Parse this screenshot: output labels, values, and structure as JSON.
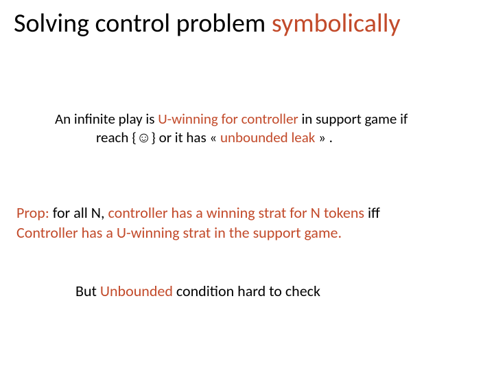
{
  "title": {
    "plain": "Solving control problem ",
    "accent": "symbolically"
  },
  "para1": {
    "line1_a": "An infinite play is ",
    "line1_u": "U-winning for controller",
    "line1_b": " in support game if",
    "line2_a": "reach {",
    "line2_smile": "☺",
    "line2_b": "} or it has « ",
    "line2_u": "unbounded leak",
    "line2_c": " » ."
  },
  "para2": {
    "l1_a": "Prop: ",
    "l1_b": "for all N, ",
    "l1_c": "controller has a winning  strat for N tokens ",
    "l1_d": "iff",
    "l2": "Controller has a U-winning strat in the support game."
  },
  "para3": {
    "a": "But ",
    "u": "Unbounded",
    "b": " condition hard to check"
  }
}
